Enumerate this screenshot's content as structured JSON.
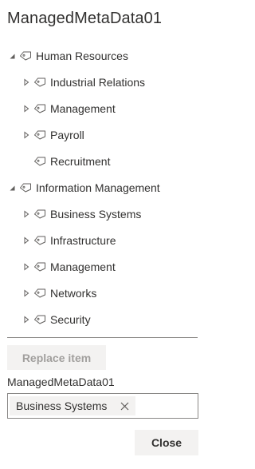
{
  "title": "ManagedMetaData01",
  "tree": [
    {
      "label": "Human Resources",
      "expanded": true,
      "has_children": true,
      "level": 0
    },
    {
      "label": "Industrial Relations",
      "expanded": false,
      "has_children": true,
      "level": 1
    },
    {
      "label": "Management",
      "expanded": false,
      "has_children": true,
      "level": 1
    },
    {
      "label": "Payroll",
      "expanded": false,
      "has_children": true,
      "level": 1
    },
    {
      "label": "Recruitment",
      "expanded": false,
      "has_children": false,
      "level": 1
    },
    {
      "label": "Information Management",
      "expanded": true,
      "has_children": true,
      "level": 0
    },
    {
      "label": "Business Systems",
      "expanded": false,
      "has_children": true,
      "level": 1
    },
    {
      "label": "Infrastructure",
      "expanded": false,
      "has_children": true,
      "level": 1
    },
    {
      "label": "Management",
      "expanded": false,
      "has_children": true,
      "level": 1
    },
    {
      "label": "Networks",
      "expanded": false,
      "has_children": true,
      "level": 1
    },
    {
      "label": "Security",
      "expanded": false,
      "has_children": true,
      "level": 1
    }
  ],
  "replace_button": {
    "label": "Replace item",
    "disabled": true
  },
  "field": {
    "label": "ManagedMetaData01",
    "selected_term": "Business Systems"
  },
  "close_button": {
    "label": "Close"
  },
  "icons": {
    "expanded": "caret-down-icon",
    "collapsed": "caret-right-icon",
    "term": "tag-icon",
    "remove": "close-icon"
  },
  "colors": {
    "text": "#323130",
    "disabled_text": "#a19f9d",
    "button_bg": "#f3f2f1",
    "border": "#8a8886"
  }
}
